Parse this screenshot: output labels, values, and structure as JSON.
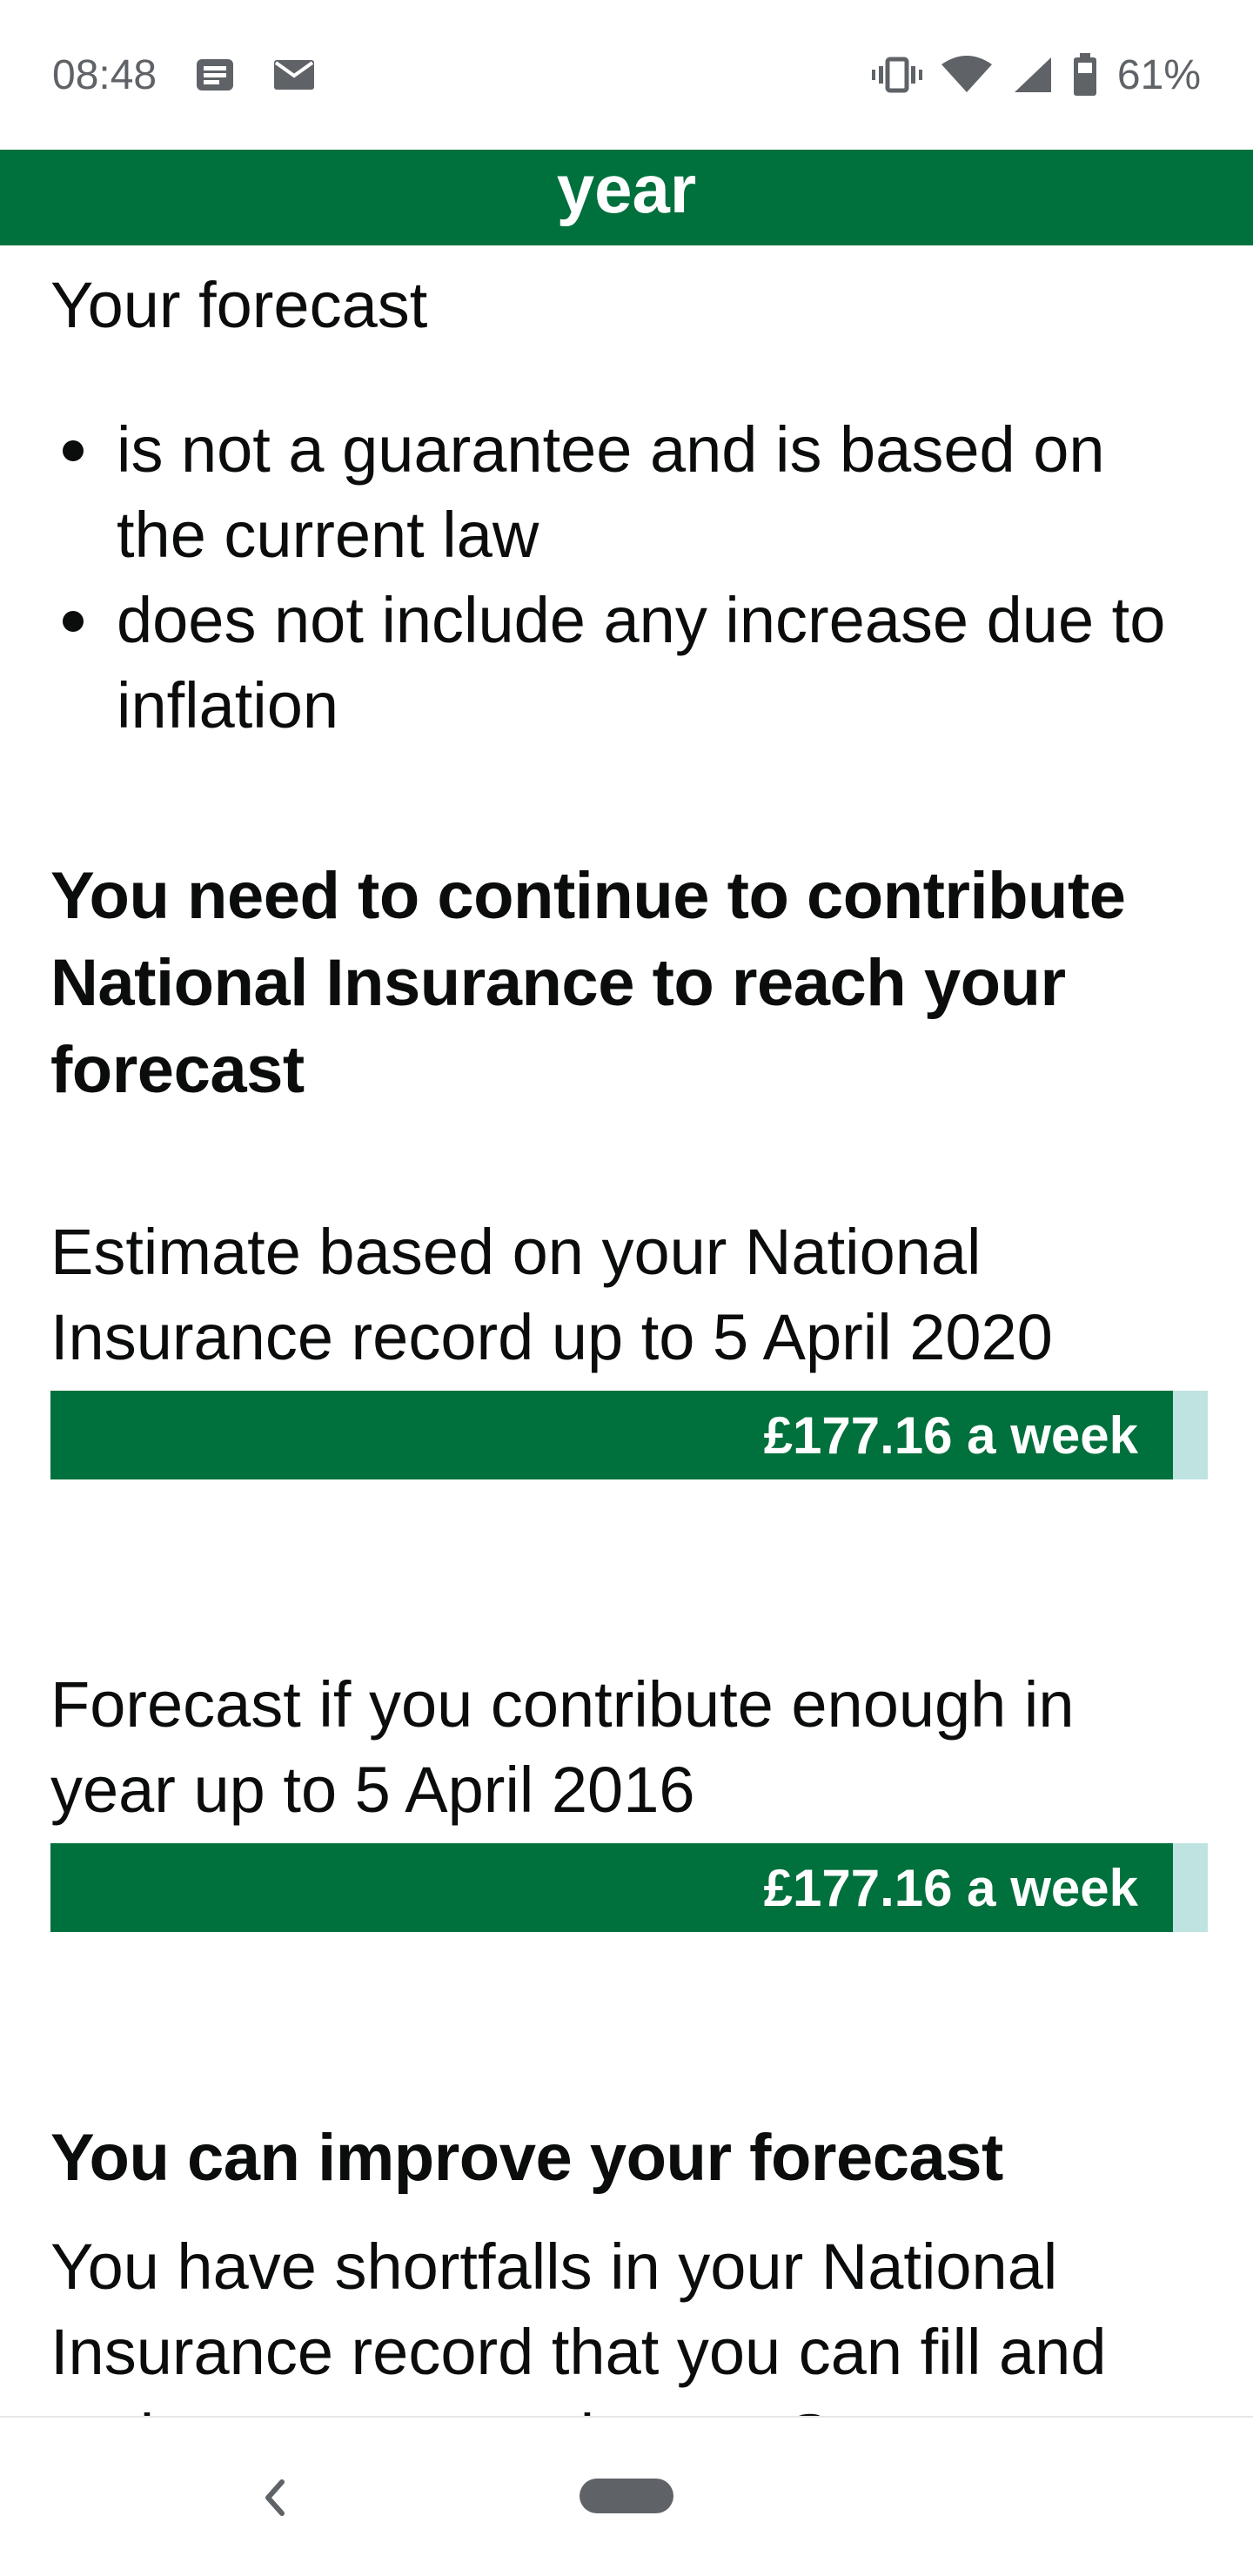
{
  "status_bar": {
    "time": "08:48",
    "battery_percent": "61%",
    "icons": [
      "news-icon",
      "mail-icon",
      "vibrate-icon",
      "wifi-icon",
      "signal-icon",
      "battery-icon"
    ]
  },
  "header": {
    "title": "year",
    "color": "#00703c"
  },
  "intro": "Your forecast",
  "bullets": [
    "is not a guarantee and is based on the current law",
    "does not include any increase due to inflation"
  ],
  "continue_section": {
    "heading": "You need to continue to contribute National Insurance to reach your forecast",
    "estimate": {
      "label": "Estimate based on your National Insurance record up to 5 April 2020",
      "amount": "£177.16 a week",
      "fill_fraction": 0.97
    },
    "forecast": {
      "label": "Forecast if you contribute enough in year up to 5 April 2016",
      "amount": "£177.16 a week",
      "fill_fraction": 0.97
    }
  },
  "improve_section": {
    "heading": "You can improve your forecast",
    "text": "You have shortfalls in your National Insurance record that you can fill and make count towards your State"
  },
  "colors": {
    "bar_fill": "#00703c",
    "bar_track": "#bfe3e0",
    "text": "#0b0c0c"
  }
}
